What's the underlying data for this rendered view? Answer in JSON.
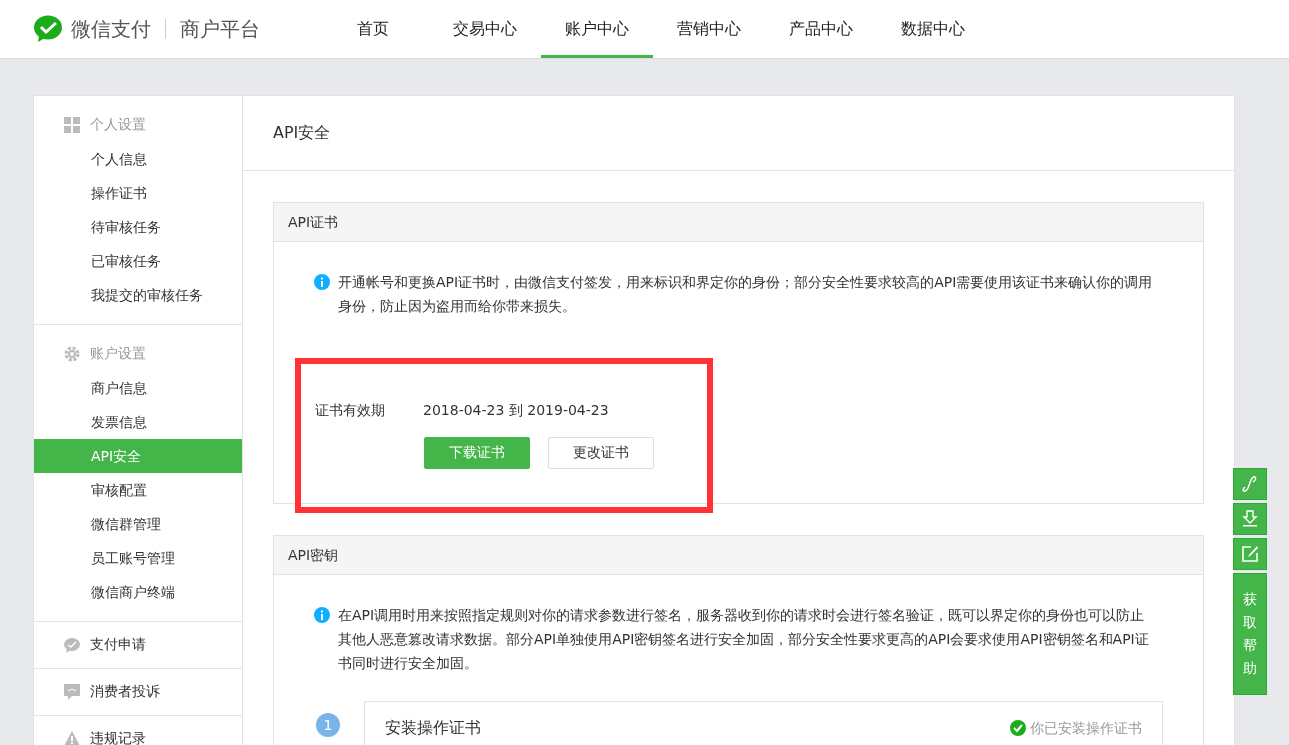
{
  "header": {
    "brand": "微信支付",
    "platform": "商户平台"
  },
  "nav": [
    {
      "label": "首页",
      "selected": false
    },
    {
      "label": "交易中心",
      "selected": false
    },
    {
      "label": "账户中心",
      "selected": true
    },
    {
      "label": "营销中心",
      "selected": false
    },
    {
      "label": "产品中心",
      "selected": false
    },
    {
      "label": "数据中心",
      "selected": false
    }
  ],
  "sidebar": {
    "groups": [
      {
        "title": "个人设置",
        "kind": "grid",
        "items": [
          {
            "label": "个人信息",
            "selected": false
          },
          {
            "label": "操作证书",
            "selected": false
          },
          {
            "label": "待审核任务",
            "selected": false
          },
          {
            "label": "已审核任务",
            "selected": false
          },
          {
            "label": "我提交的审核任务",
            "selected": false
          }
        ]
      },
      {
        "title": "账户设置",
        "kind": "gear",
        "items": [
          {
            "label": "商户信息",
            "selected": false
          },
          {
            "label": "发票信息",
            "selected": false
          },
          {
            "label": "API安全",
            "selected": true
          },
          {
            "label": "审核配置",
            "selected": false
          },
          {
            "label": "微信群管理",
            "selected": false
          },
          {
            "label": "员工账号管理",
            "selected": false
          },
          {
            "label": "微信商户终端",
            "selected": false
          }
        ]
      },
      {
        "title": "支付申请",
        "kind": "chat"
      },
      {
        "title": "消费者投诉",
        "kind": "message"
      },
      {
        "title": "违规记录",
        "kind": "warning"
      }
    ]
  },
  "page_title": "API安全",
  "sections": [
    {
      "title": "API证书",
      "info": "开通帐号和更换API证书时，由微信支付签发，用来标识和界定你的身份；部分安全性要求较高的API需要使用该证书来确认你的调用身份，防止因为盗用而给你带来损失。",
      "fields": [
        {
          "label": "证书有效期",
          "value": "2018-04-23  到  2019-04-23"
        }
      ],
      "buttons": [
        {
          "label": "下载证书",
          "kind": "primary"
        },
        {
          "label": "更改证书",
          "kind": "default"
        }
      ],
      "highlight": true
    },
    {
      "title": "API密钥",
      "info": "在API调用时用来按照指定规则对你的请求参数进行签名，服务器收到你的请求时会进行签名验证，既可以界定你的身份也可以防止其他人恶意篡改请求数据。部分API单独使用API密钥签名进行安全加固，部分安全性要求更高的API会要求使用API密钥签名和API证书同时进行安全加固。",
      "steps": [
        {
          "number": "1",
          "title": "安装操作证书",
          "status": "你已安装操作证书"
        }
      ],
      "highlight": false
    }
  ],
  "float_tools": [
    {
      "kind": "link"
    },
    {
      "kind": "download"
    },
    {
      "kind": "edit"
    }
  ],
  "help_button": "获取帮助"
}
